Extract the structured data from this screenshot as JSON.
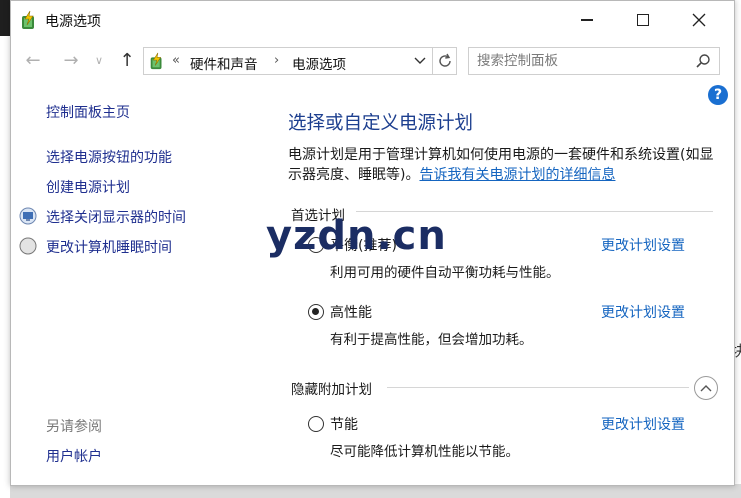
{
  "window": {
    "title": "电源选项"
  },
  "nav": {
    "back_glyph": "←",
    "forward_glyph": "→",
    "recent_glyph": "∨",
    "up_glyph": "↑"
  },
  "address": {
    "overflow": "«",
    "breadcrumb": [
      "硬件和声音",
      "电源选项"
    ],
    "separator": "›"
  },
  "search": {
    "placeholder": "搜索控制面板"
  },
  "sidebar": {
    "home": "控制面板主页",
    "links": [
      {
        "label": "选择电源按钮的功能",
        "icon": "none"
      },
      {
        "label": "创建电源计划",
        "icon": "none"
      },
      {
        "label": "选择关闭显示器的时间",
        "icon": "monitor-icon"
      },
      {
        "label": "更改计算机睡眠时间",
        "icon": "moon-icon"
      }
    ],
    "see_also": "另请参阅",
    "see_also_links": [
      "用户帐户"
    ]
  },
  "main": {
    "heading": "选择或自定义电源计划",
    "description": "电源计划是用于管理计算机如何使用电源的一套硬件和系统设置(如显示器亮度、睡眠等)。",
    "description_link": "告诉我有关电源计划的详细信息",
    "preferred_label": "首选计划",
    "hidden_label": "隐藏附加计划",
    "change_link": "更改计划设置",
    "plans": [
      {
        "name": "平衡(推荐)",
        "desc": "利用可用的硬件自动平衡功耗与性能。",
        "selected": false
      },
      {
        "name": "高性能",
        "desc": "有利于提高性能，但会增加功耗。",
        "selected": true
      },
      {
        "name": "节能",
        "desc": "尽可能降低计算机性能以节能。",
        "selected": false
      }
    ]
  },
  "overlay": {
    "watermark": "yzdn.cn"
  },
  "desktop": {
    "edge_char": "块"
  },
  "colors": {
    "heading": "#1d3f8f",
    "link": "#1565c0",
    "sidebar_link": "#1f2f8f",
    "help": "#1a6fd1"
  }
}
